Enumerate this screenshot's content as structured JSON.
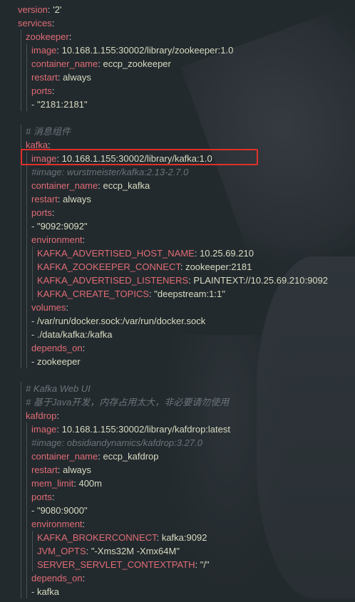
{
  "colors": {
    "background": "#232a2e",
    "key": "#e06c75",
    "value": "#d8dbc1",
    "comment": "#6a747a",
    "highlight": "#e0302a"
  },
  "lines": [
    {
      "indent": 0,
      "key": "version",
      "value": "'2'"
    },
    {
      "indent": 0,
      "key": "services",
      "value": ""
    },
    {
      "indent": 1,
      "key": "zookeeper",
      "value": ""
    },
    {
      "indent": 2,
      "key": "image",
      "value": "10.168.1.155:30002/library/zookeeper:1.0"
    },
    {
      "indent": 2,
      "key": "container_name",
      "value": "eccp_zookeeper"
    },
    {
      "indent": 2,
      "key": "restart",
      "value": "always"
    },
    {
      "indent": 2,
      "key": "ports",
      "value": ""
    },
    {
      "indent": 2,
      "item": "\"2181:2181\""
    },
    {
      "indent": 0,
      "blank": true
    },
    {
      "indent": 1,
      "comment": "# 消息组件"
    },
    {
      "indent": 1,
      "key": "kafka",
      "value": ""
    },
    {
      "indent": 2,
      "key": "image",
      "value": "10.168.1.155:30002/library/kafka:1.0",
      "highlighted": true
    },
    {
      "indent": 2,
      "comment": "#image: wurstmeister/kafka:2.13-2.7.0"
    },
    {
      "indent": 2,
      "key": "container_name",
      "value": "eccp_kafka"
    },
    {
      "indent": 2,
      "key": "restart",
      "value": "always"
    },
    {
      "indent": 2,
      "key": "ports",
      "value": ""
    },
    {
      "indent": 2,
      "item": "\"9092:9092\""
    },
    {
      "indent": 2,
      "key": "environment",
      "value": ""
    },
    {
      "indent": 3,
      "key": "KAFKA_ADVERTISED_HOST_NAME",
      "value": "10.25.69.210"
    },
    {
      "indent": 3,
      "key": "KAFKA_ZOOKEEPER_CONNECT",
      "value": "zookeeper:2181"
    },
    {
      "indent": 3,
      "key": "KAFKA_ADVERTISED_LISTENERS",
      "value": "PLAINTEXT://10.25.69.210:9092"
    },
    {
      "indent": 3,
      "key": "KAFKA_CREATE_TOPICS",
      "value": "\"deepstream:1:1\""
    },
    {
      "indent": 2,
      "key": "volumes",
      "value": ""
    },
    {
      "indent": 2,
      "item": "/var/run/docker.sock:/var/run/docker.sock"
    },
    {
      "indent": 2,
      "item": "./data/kafka:/kafka"
    },
    {
      "indent": 2,
      "key": "depends_on",
      "value": ""
    },
    {
      "indent": 2,
      "item": "zookeeper"
    },
    {
      "indent": 0,
      "blank": true
    },
    {
      "indent": 1,
      "comment": "# Kafka Web UI"
    },
    {
      "indent": 1,
      "comment": "# 基于Java开发，内存占用太大，非必要请勿使用"
    },
    {
      "indent": 1,
      "key": "kafdrop",
      "value": ""
    },
    {
      "indent": 2,
      "key": "image",
      "value": "10.168.1.155:30002/library/kafdrop:latest"
    },
    {
      "indent": 2,
      "comment": "#image: obsidiandynamics/kafdrop:3.27.0"
    },
    {
      "indent": 2,
      "key": "container_name",
      "value": "eccp_kafdrop"
    },
    {
      "indent": 2,
      "key": "restart",
      "value": "always"
    },
    {
      "indent": 2,
      "key": "mem_limit",
      "value": "400m"
    },
    {
      "indent": 2,
      "key": "ports",
      "value": ""
    },
    {
      "indent": 2,
      "item": "\"9080:9000\""
    },
    {
      "indent": 2,
      "key": "environment",
      "value": ""
    },
    {
      "indent": 3,
      "key": "KAFKA_BROKERCONNECT",
      "value": "kafka:9092"
    },
    {
      "indent": 3,
      "key": "JVM_OPTS",
      "value": "\"-Xms32M -Xmx64M\""
    },
    {
      "indent": 3,
      "key": "SERVER_SERVLET_CONTEXTPATH",
      "value": "\"/\""
    },
    {
      "indent": 2,
      "key": "depends_on",
      "value": ""
    },
    {
      "indent": 2,
      "item": "kafka"
    }
  ]
}
